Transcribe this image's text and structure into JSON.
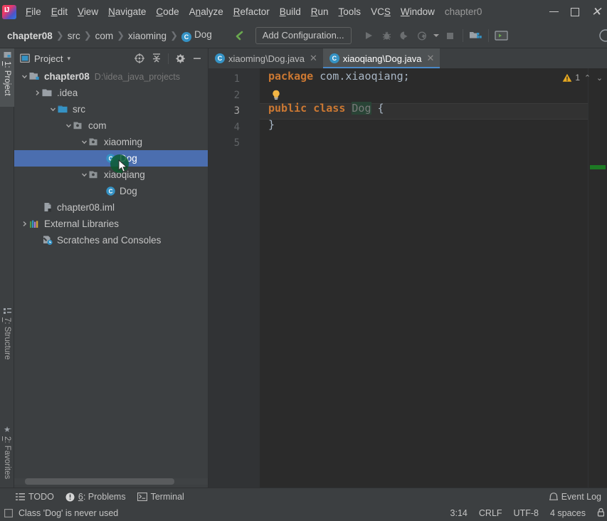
{
  "window": {
    "title_app": "chapter0",
    "controls": {
      "minimize": "—",
      "maximize": "▢",
      "close": "✕"
    }
  },
  "menubar": {
    "items": [
      {
        "label": "File",
        "mnemonic": "F"
      },
      {
        "label": "Edit",
        "mnemonic": "E"
      },
      {
        "label": "View",
        "mnemonic": "V"
      },
      {
        "label": "Navigate",
        "mnemonic": "N"
      },
      {
        "label": "Code",
        "mnemonic": "C"
      },
      {
        "label": "Analyze",
        "mnemonic": "A"
      },
      {
        "label": "Refactor",
        "mnemonic": "R"
      },
      {
        "label": "Build",
        "mnemonic": "B"
      },
      {
        "label": "Run",
        "mnemonic": "R"
      },
      {
        "label": "Tools",
        "mnemonic": "T"
      },
      {
        "label": "VCS",
        "mnemonic": "S"
      },
      {
        "label": "Window",
        "mnemonic": "W"
      }
    ]
  },
  "navbar": {
    "breadcrumbs": [
      {
        "label": "chapter08",
        "icon": "",
        "bold": true
      },
      {
        "label": "src",
        "icon": "",
        "bold": false
      },
      {
        "label": "com",
        "icon": "",
        "bold": false
      },
      {
        "label": "xiaoming",
        "icon": "",
        "bold": false
      },
      {
        "label": "Dog",
        "icon": "class-icon",
        "bold": false
      }
    ],
    "separator": "❯",
    "add_configuration": "Add Configuration...",
    "icons": [
      "back-arrow-icon",
      "run-icon",
      "debug-icon",
      "run-coverage-icon",
      "profiler-icon",
      "dropdown-icon",
      "stop-icon",
      "project-structure-icon",
      "terminal-icon"
    ]
  },
  "left_rail": {
    "buttons": [
      {
        "label": "1: Project",
        "num": "1",
        "active": true,
        "icon": "project-icon"
      },
      {
        "label": "7: Structure",
        "num": "7",
        "active": false,
        "icon": "structure-icon"
      },
      {
        "label": "2: Favorites",
        "num": "2",
        "active": false,
        "icon": "star-icon"
      }
    ]
  },
  "project_panel": {
    "title": "Project",
    "dropdown_caret": "▾",
    "tools": [
      "locate-icon",
      "collapse-all-icon",
      "settings-gear-icon",
      "hide-icon"
    ],
    "tree": [
      {
        "indent": 0,
        "arrow": "down",
        "icon": "module-icon",
        "label": "chapter08",
        "bold": true,
        "path": "D:\\idea_java_projects",
        "selected": false
      },
      {
        "indent": 1,
        "arrow": "right",
        "icon": "folder-icon",
        "label": ".idea",
        "bold": false,
        "path": "",
        "selected": false
      },
      {
        "indent": 1,
        "arrow": "down",
        "icon": "src-folder-icon",
        "label": "src",
        "bold": false,
        "path": "",
        "selected": false
      },
      {
        "indent": 2,
        "arrow": "down",
        "icon": "package-icon",
        "label": "com",
        "bold": false,
        "path": "",
        "selected": false
      },
      {
        "indent": 3,
        "arrow": "down",
        "icon": "package-icon",
        "label": "xiaoming",
        "bold": false,
        "path": "",
        "selected": false
      },
      {
        "indent": 4,
        "arrow": "none",
        "icon": "class-icon",
        "label": "Dog",
        "bold": false,
        "path": "",
        "selected": true
      },
      {
        "indent": 3,
        "arrow": "down",
        "icon": "package-icon",
        "label": "xiaoqiang",
        "bold": false,
        "path": "",
        "selected": false
      },
      {
        "indent": 4,
        "arrow": "none",
        "icon": "class-icon",
        "label": "Dog",
        "bold": false,
        "path": "",
        "selected": false
      },
      {
        "indent": 1,
        "arrow": "none",
        "icon": "iml-file-icon",
        "label": "chapter08.iml",
        "bold": false,
        "path": "",
        "selected": false
      },
      {
        "indent": 0,
        "arrow": "right",
        "icon": "libraries-icon",
        "label": "External Libraries",
        "bold": false,
        "path": "",
        "selected": false
      },
      {
        "indent": 0,
        "arrow": "none",
        "icon": "scratches-icon",
        "label": "Scratches and Consoles",
        "bold": false,
        "path": "",
        "selected": false
      }
    ]
  },
  "editor": {
    "tabs": [
      {
        "label": "xiaoming\\Dog.java",
        "icon": "class-icon",
        "active": false,
        "close": "✕"
      },
      {
        "label": "xiaoqiang\\Dog.java",
        "icon": "class-icon",
        "active": true,
        "close": "✕"
      }
    ],
    "line_numbers": [
      "1",
      "2",
      "3",
      "4",
      "5"
    ],
    "current_line": 3,
    "code_lines": [
      {
        "n": 1,
        "tokens": [
          {
            "t": "package",
            "c": "kw"
          },
          {
            "t": " com.xiaoqiang;",
            "c": "pl"
          }
        ]
      },
      {
        "n": 2,
        "tokens": []
      },
      {
        "n": 3,
        "tokens": [
          {
            "t": "public",
            "c": "kw"
          },
          {
            "t": " ",
            "c": "pl"
          },
          {
            "t": "class",
            "c": "kw"
          },
          {
            "t": " ",
            "c": "pl"
          },
          {
            "t": "Dog",
            "c": "unused"
          },
          {
            "t": " {",
            "c": "pl"
          }
        ]
      },
      {
        "n": 4,
        "tokens": [
          {
            "t": "}",
            "c": "pl"
          }
        ]
      },
      {
        "n": 5,
        "tokens": []
      }
    ],
    "inspection": {
      "icon": "warning-triangle-icon",
      "count": "1",
      "prev": "⌃",
      "next": "⌄"
    },
    "intention_bulb": "lightbulb-icon"
  },
  "tool_window_bar": {
    "buttons": [
      {
        "label": "TODO",
        "icon": "todo-icon",
        "num": ""
      },
      {
        "label": "6: Problems",
        "icon": "problems-icon",
        "num": "6"
      },
      {
        "label": "Terminal",
        "icon": "terminal-icon",
        "num": ""
      }
    ],
    "event_log": {
      "label": "Event Log",
      "icon": "event-log-icon"
    }
  },
  "statusbar": {
    "message": "Class 'Dog' is never used",
    "message_icon": "inspection-icon",
    "caret_position": "3:14",
    "line_separator": "CRLF",
    "encoding": "UTF-8",
    "indent": "4 spaces",
    "lock_icon": "lock-icon"
  },
  "colors": {
    "accent_blue": "#4b6eaf",
    "tab_underline": "#4a88c7",
    "keyword_orange": "#cc7832",
    "unused_green_bg": "#294436",
    "editor_bg": "#2b2b2b",
    "chrome_bg": "#3c3f41",
    "click_marker_green": "#0a5a2d"
  }
}
